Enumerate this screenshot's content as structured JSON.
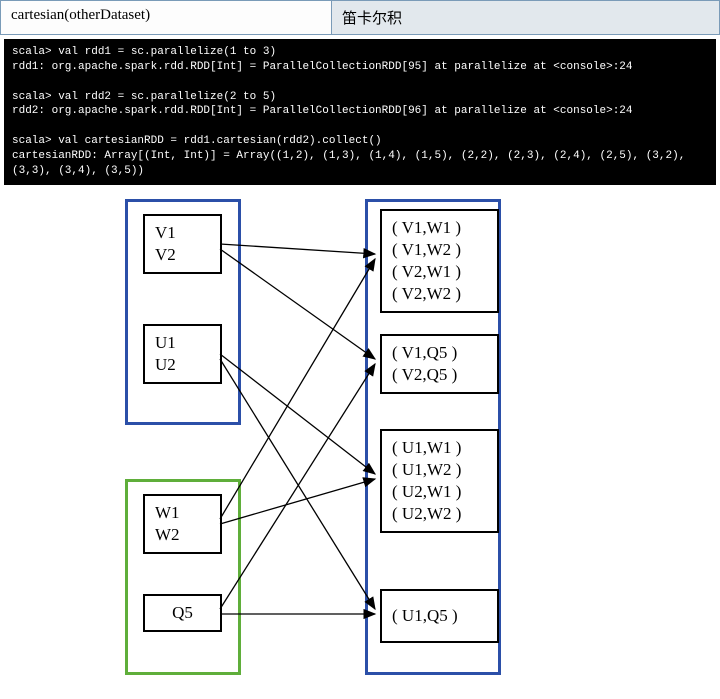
{
  "header": {
    "left": "cartesian(otherDataset)",
    "right": "笛卡尔积"
  },
  "terminal": {
    "line1": "scala> val rdd1 = sc.parallelize(1 to 3)",
    "line2": "rdd1: org.apache.spark.rdd.RDD[Int] = ParallelCollectionRDD[95] at parallelize at <console>:24",
    "line3": "",
    "line4": "scala> val rdd2 = sc.parallelize(2 to 5)",
    "line5": "rdd2: org.apache.spark.rdd.RDD[Int] = ParallelCollectionRDD[96] at parallelize at <console>:24",
    "line6": "",
    "line7": "scala> val cartesianRDD = rdd1.cartesian(rdd2).collect()",
    "line8": "cartesianRDD: Array[(Int, Int)] = Array((1,2), (1,3), (1,4), (1,5), (2,2), (2,3), (2,4), (2,5), (3,2), (3,3), (3,4), (3,5))"
  },
  "diagram": {
    "left_top": {
      "p1": [
        "V1",
        "V2"
      ],
      "p2": [
        "U1",
        "U2"
      ]
    },
    "left_bottom": {
      "p1": [
        "W1",
        "W2"
      ],
      "p2": [
        "Q5"
      ]
    },
    "right": {
      "r1": [
        "( V1,W1 )",
        "( V1,W2 )",
        "( V2,W1 )",
        "( V2,W2 )"
      ],
      "r2": [
        "( V1,Q5 )",
        "( V2,Q5 )"
      ],
      "r3": [
        "( U1,W1 )",
        "( U1,W2 )",
        "( U2,W1 )",
        "( U2,W2 )"
      ],
      "r4": [
        "( U1,Q5 )"
      ]
    }
  }
}
